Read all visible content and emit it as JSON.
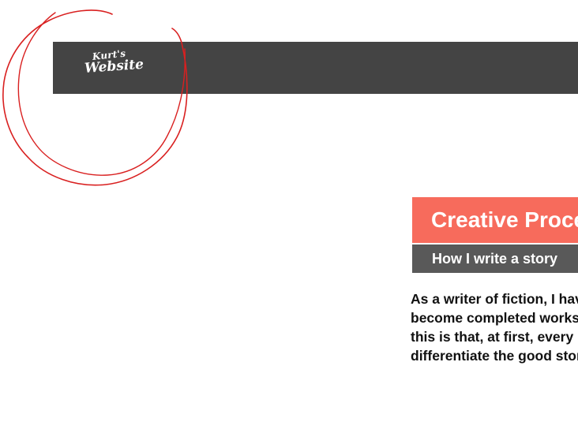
{
  "header": {
    "logo": {
      "line1": "Kurt's",
      "line2": "Website"
    }
  },
  "hero": {
    "title": "Creative Process",
    "subtitle": "How I write a story"
  },
  "intro": {
    "lines": [
      "As a writer of fiction, I have",
      "become completed works and",
      "this is that, at first, every",
      "differentiate the good stories"
    ]
  },
  "colors": {
    "header_bg": "#444444",
    "title_bg": "#f76b5c",
    "subtitle_bg": "#595959",
    "annotation_stroke": "#d92020"
  }
}
